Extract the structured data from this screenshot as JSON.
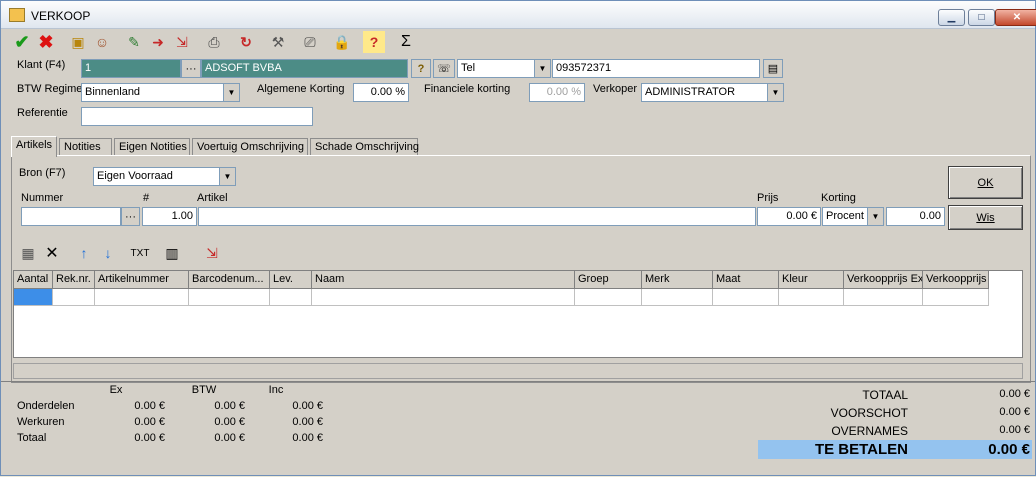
{
  "window": {
    "title": "VERKOOP"
  },
  "header": {
    "klant_label": "Klant (F4)",
    "klant_nr": "1",
    "klant_naam": "ADSOFT BVBA",
    "contact_type": "Tel",
    "contact_value": "093572371",
    "btw_label": "BTW Regime",
    "btw_value": "Binnenland",
    "korting_label": "Algemene Korting",
    "korting_value": "0.00 %",
    "fin_korting_label": "Financiele korting",
    "fin_korting_value": "0.00 %",
    "verkoper_label": "Verkoper",
    "verkoper_value": "ADMINISTRATOR",
    "referentie_label": "Referentie",
    "referentie_value": ""
  },
  "tabs": [
    "Artikels",
    "Notities",
    "Eigen Notities",
    "Voertuig Omschrijving",
    "Schade Omschrijving"
  ],
  "artikels": {
    "bron_label": "Bron (F7)",
    "bron_value": "Eigen Voorraad",
    "nummer_label": "Nummer",
    "qty_label": "#",
    "artikel_label": "Artikel",
    "prijs_label": "Prijs",
    "korting_label": "Korting",
    "nummer_value": "",
    "qty_value": "1.00",
    "artikel_value": "",
    "prijs_value": "0.00 €",
    "korting_type": "Procent",
    "korting_value": "0.00",
    "ok_label": "OK",
    "wis_label": "Wis",
    "txt_label": "TXT"
  },
  "grid": {
    "columns": [
      "Aantal",
      "Rek.nr.",
      "Artikelnummer",
      "Barcodenum...",
      "Lev.",
      "Naam",
      "Groep",
      "Merk",
      "Maat",
      "Kleur",
      "Verkoopprijs Ex",
      "Verkoopprijs"
    ]
  },
  "summary": {
    "headers": [
      "Ex",
      "BTW",
      "Inc"
    ],
    "rows": [
      {
        "label": "Onderdelen",
        "ex": "0.00 €",
        "btw": "0.00 €",
        "inc": "0.00 €"
      },
      {
        "label": "Werkuren",
        "ex": "0.00 €",
        "btw": "0.00 €",
        "inc": "0.00 €"
      },
      {
        "label": "Totaal",
        "ex": "0.00 €",
        "btw": "0.00 €",
        "inc": "0.00 €"
      }
    ]
  },
  "totals": [
    {
      "label": "TOTAAL",
      "value": "0.00 €"
    },
    {
      "label": "VOORSCHOT",
      "value": "0.00 €"
    },
    {
      "label": "OVERNAMES",
      "value": "0.00 €"
    }
  ],
  "te_betalen": {
    "label": "TE BETALEN",
    "value": "0.00 €"
  },
  "colors": {
    "accent_teal": "#4c8c86",
    "selection": "#3d8ee8",
    "pay_bg": "#94c3ef"
  }
}
